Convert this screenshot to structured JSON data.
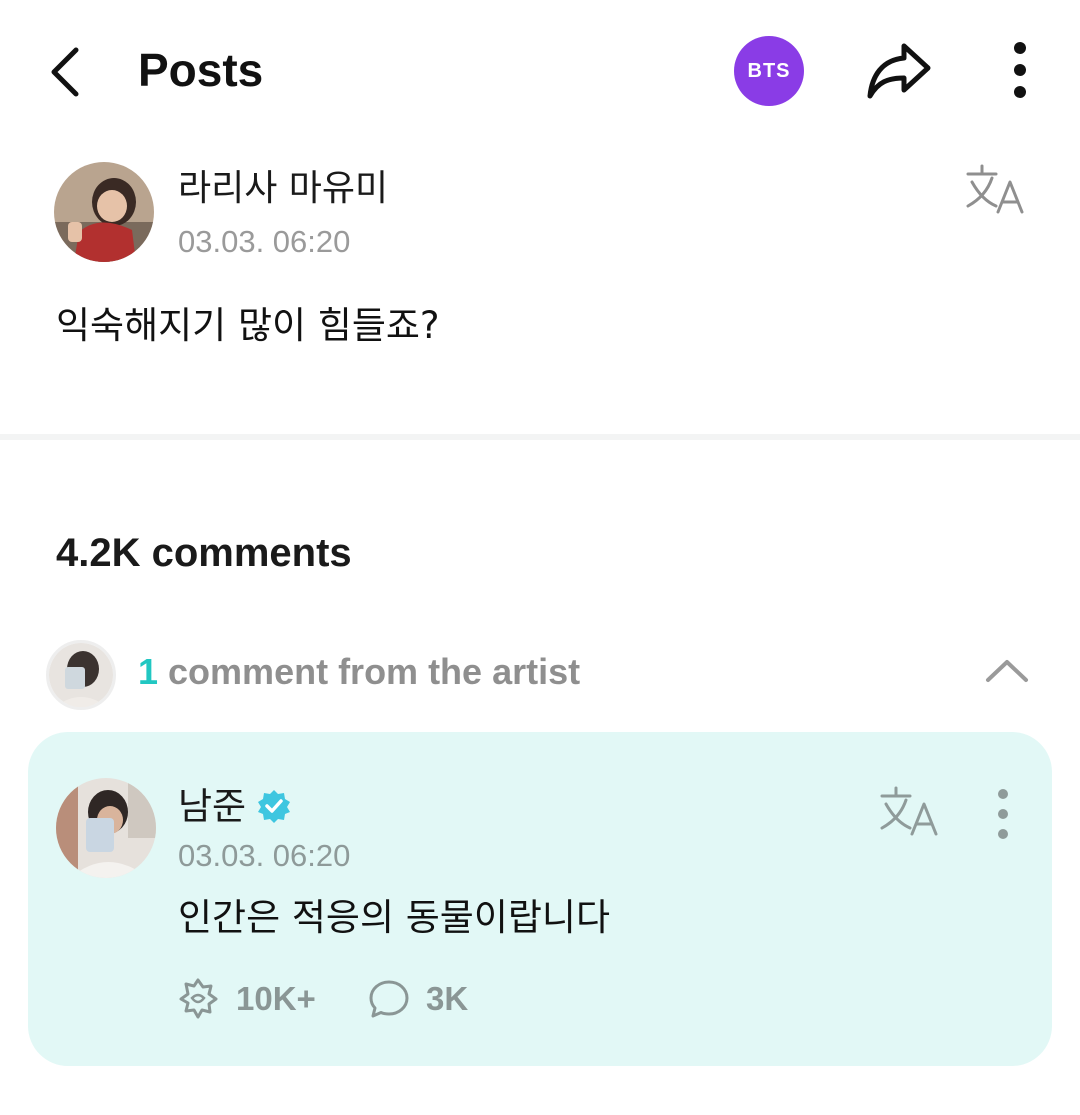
{
  "header": {
    "title": "Posts",
    "community_badge": "BTS",
    "colors": {
      "badge": "#8a3ce6"
    },
    "icons": [
      "chevron-left-icon",
      "share-icon",
      "more-vertical-icon"
    ]
  },
  "post": {
    "author": "라리사 마유미",
    "timestamp": "03.03. 06:20",
    "body": "익숙해지기 많이 힘들죠?",
    "icons": [
      "avatar",
      "translate-icon"
    ]
  },
  "comments": {
    "count_label": "4.2K comments",
    "artist_section": {
      "count": "1",
      "label": "comment from the artist",
      "colors": {
        "count": "#21c7c2",
        "card_background": "#e2f8f6"
      },
      "icons": [
        "chevron-up-icon"
      ]
    },
    "artist_comment": {
      "author": "남준",
      "verified": true,
      "timestamp": "03.03. 06:20",
      "body": "인간은 적응의 동물이랍니다",
      "likes": "10K+",
      "replies": "3K",
      "icons": [
        "verified-icon",
        "translate-icon",
        "more-vertical-icon",
        "like-icon",
        "comment-icon"
      ]
    }
  }
}
